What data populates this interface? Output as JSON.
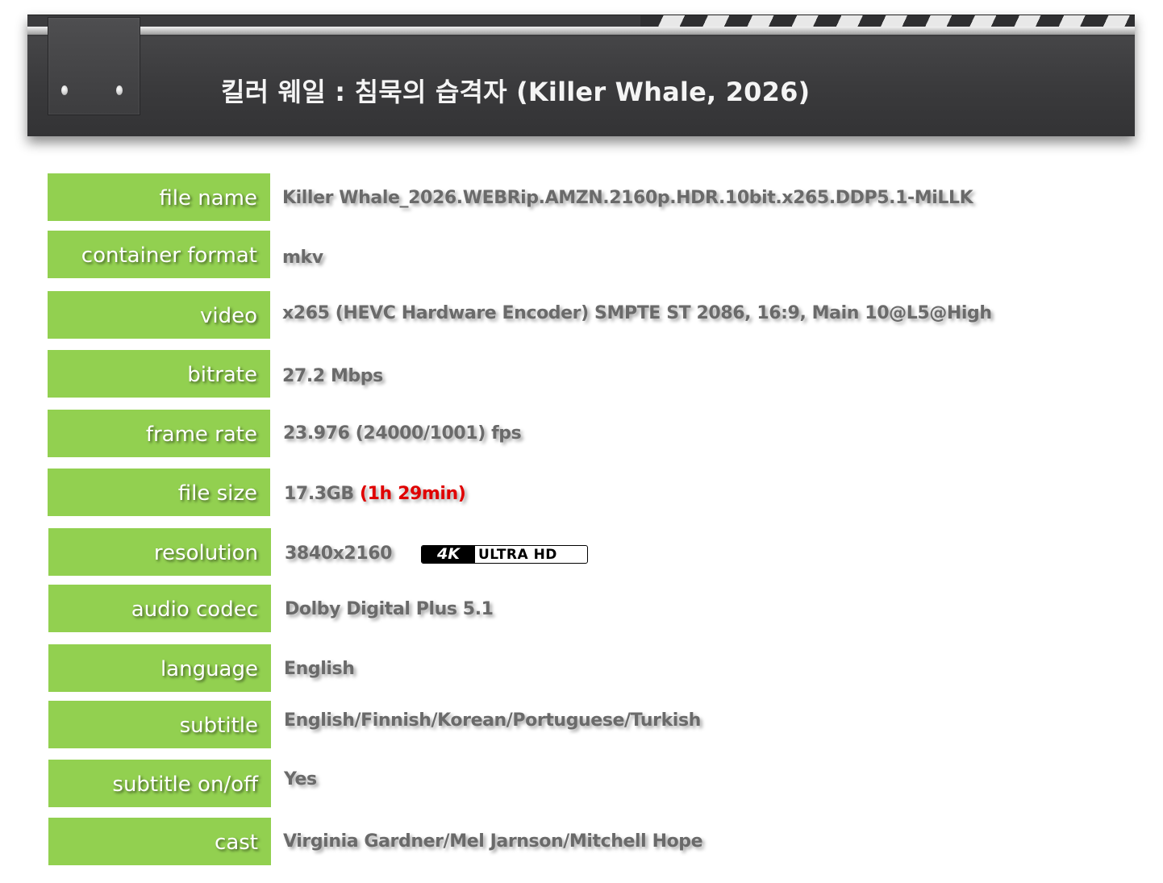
{
  "header": {
    "title": "킬러 웨일 : 침묵의 습격자 (Killer Whale, 2026)"
  },
  "rows": {
    "file_name": {
      "label": "file name",
      "value": "Killer Whale_2026.WEBRip.AMZN.2160p.HDR.10bit.x265.DDP5.1-MiLLK"
    },
    "container": {
      "label": "container format",
      "value": "mkv"
    },
    "video": {
      "label": "video",
      "value": "x265 (HEVC Hardware Encoder) SMPTE ST 2086, 16:9, Main 10@L5@High"
    },
    "bitrate": {
      "label": "bitrate",
      "value": "27.2 Mbps"
    },
    "frame_rate": {
      "label": "frame rate",
      "value": "23.976 (24000/1001) fps"
    },
    "file_size": {
      "label": "file size",
      "value": "17.3GB",
      "runtime": "(1h 29min)"
    },
    "resolution": {
      "label": "resolution",
      "value": "3840x2160",
      "badge_4k": "4K",
      "badge_uhd": "ULTRA HD"
    },
    "audio_codec": {
      "label": "audio codec",
      "value": "Dolby Digital Plus 5.1"
    },
    "language": {
      "label": "language",
      "value": "English"
    },
    "subtitle": {
      "label": "subtitle",
      "value": "English/Finnish/Korean/Portuguese/Turkish"
    },
    "subtitle_onoff": {
      "label": "subtitle on/off",
      "value": "Yes"
    },
    "cast": {
      "label": "cast",
      "value": "Virginia Gardner/Mel Jarnson/Mitchell Hope"
    }
  },
  "colors": {
    "label_background": "#92d050",
    "value_text": "#6a6a6a",
    "runtime_text": "#e00000",
    "clapper_body": "#3a3a3c"
  }
}
